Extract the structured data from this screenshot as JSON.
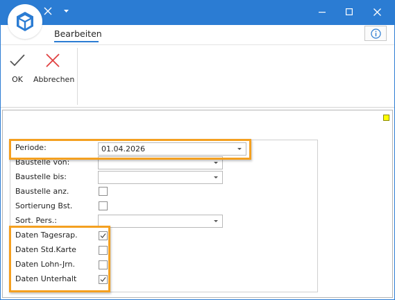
{
  "window": {
    "accent_color": "#2b7cd3",
    "minimize_icon": "minimize-icon",
    "maximize_icon": "maximize-icon",
    "close_icon": "close-icon"
  },
  "quick_access": {
    "icons": [
      "cube-logo-icon",
      "close-x-icon",
      "dropdown-arrow-icon"
    ]
  },
  "ribbon": {
    "tab_label": "Bearbeiten",
    "ok_label": "OK",
    "cancel_label": "Abbrechen",
    "info_icon": "info-icon"
  },
  "form": {
    "periode": {
      "label": "Periode:",
      "value": "01.04.2026"
    },
    "baustelle_von": {
      "label": "Baustelle von:",
      "value": ""
    },
    "baustelle_bis": {
      "label": "Baustelle bis:",
      "value": ""
    },
    "baustelle_anz": {
      "label": "Baustelle anz.",
      "checked": false
    },
    "sortierung_bst": {
      "label": "Sortierung Bst.",
      "checked": false
    },
    "sort_pers": {
      "label": "Sort. Pers.:",
      "value": ""
    },
    "daten_tagesrap": {
      "label": "Daten Tagesrap.",
      "checked": true
    },
    "daten_std_karte": {
      "label": "Daten Std.Karte",
      "checked": false
    },
    "daten_lohn_jrn": {
      "label": "Daten Lohn-Jrn.",
      "checked": false
    },
    "daten_unterhalt": {
      "label": "Daten Unterhalt",
      "checked": true
    }
  },
  "highlight_color": "#f4a020",
  "marker_color": "#ffff00"
}
